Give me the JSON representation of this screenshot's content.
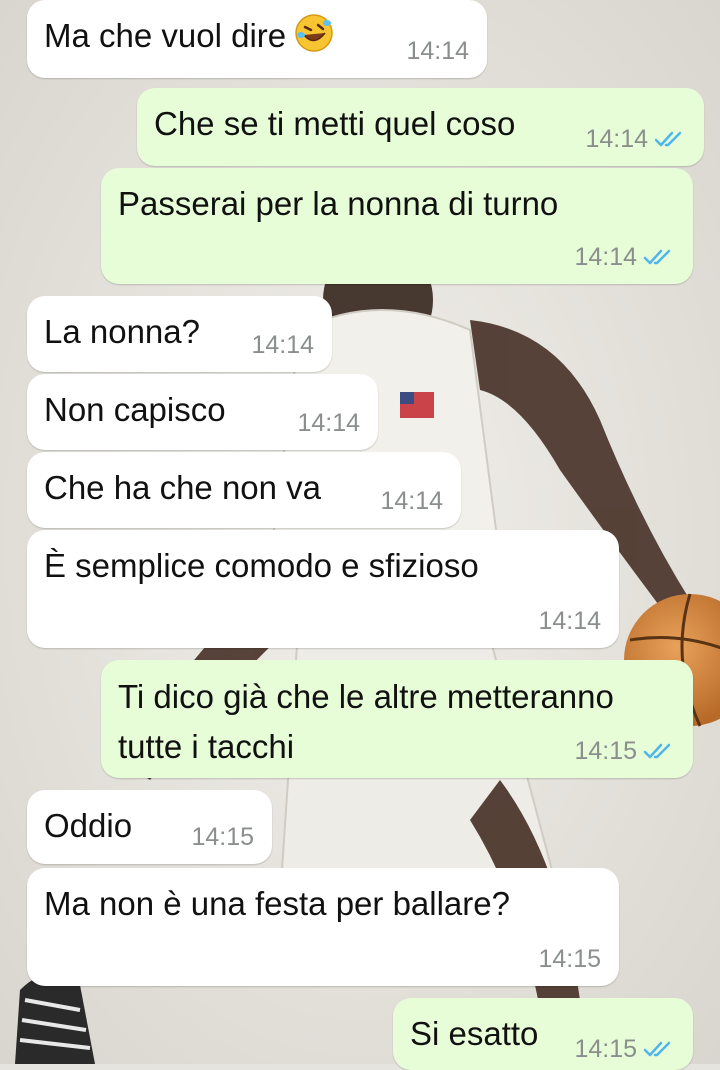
{
  "chat": {
    "messages": [
      {
        "id": "m1",
        "direction": "in",
        "text": "Ma che vuol dire",
        "emoji": "rolling-on-floor-laughing-emoji",
        "time": "14:14"
      },
      {
        "id": "m2",
        "direction": "out",
        "text": "Che se ti metti quel coso",
        "time": "14:14",
        "status": "read"
      },
      {
        "id": "m3",
        "direction": "out",
        "text": "Passerai per la nonna di turno",
        "time": "14:14",
        "status": "read"
      },
      {
        "id": "m4",
        "direction": "in",
        "text": "La nonna?",
        "time": "14:14"
      },
      {
        "id": "m5",
        "direction": "in",
        "text": "Non capisco",
        "time": "14:14"
      },
      {
        "id": "m6",
        "direction": "in",
        "text": "Che ha che non va",
        "time": "14:14"
      },
      {
        "id": "m7",
        "direction": "in",
        "text": "È semplice comodo e sfizioso",
        "time": "14:14"
      },
      {
        "id": "m8",
        "direction": "out",
        "lines": [
          "Ti dico già che le altre metteranno",
          "tutte i tacchi"
        ],
        "time": "14:15",
        "status": "read"
      },
      {
        "id": "m9",
        "direction": "in",
        "text": "Oddio",
        "time": "14:15"
      },
      {
        "id": "m10",
        "direction": "in",
        "text": "Ma non è una festa per ballare?",
        "time": "14:15"
      },
      {
        "id": "m11",
        "direction": "out",
        "text": "Si esatto",
        "time": "14:15",
        "status": "read"
      }
    ]
  },
  "colors": {
    "incoming_bubble": "#ffffff",
    "outgoing_bubble": "#e7fdd8",
    "timestamp": "#8a8f8d",
    "read_ticks": "#4fb6ec"
  },
  "wallpaper": {
    "icon": "basketball-player-wallpaper"
  }
}
